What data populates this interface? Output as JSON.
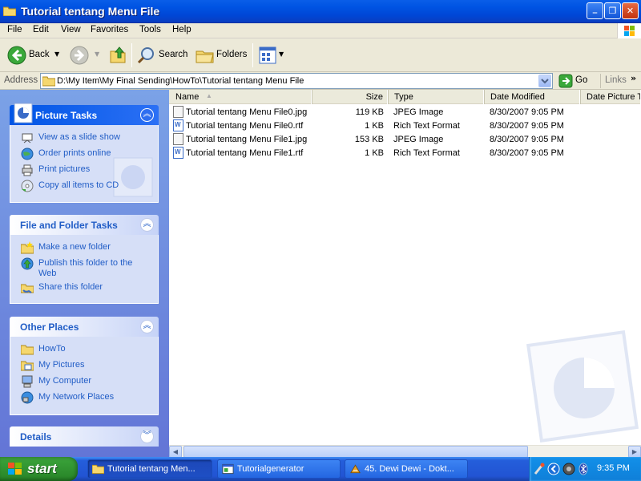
{
  "window": {
    "title": "Tutorial tentang Menu File",
    "controls": {
      "minimize": "_",
      "maximize": "❐",
      "close": "✕"
    }
  },
  "menu": [
    "File",
    "Edit",
    "View",
    "Favorites",
    "Tools",
    "Help"
  ],
  "toolbar": {
    "back": "Back",
    "search": "Search",
    "folders": "Folders"
  },
  "address": {
    "label": "Address",
    "value": "D:\\My Item\\My Final Sending\\HowTo\\Tutorial tentang Menu File",
    "go": "Go",
    "links": "Links"
  },
  "panels": {
    "picture_tasks": {
      "title": "Picture Tasks",
      "items": [
        {
          "label": "View as a slide show",
          "icon": "slideshow-icon"
        },
        {
          "label": "Order prints online",
          "icon": "globe-icon"
        },
        {
          "label": "Print pictures",
          "icon": "printer-icon"
        },
        {
          "label": "Copy all items to CD",
          "icon": "cd-icon"
        }
      ]
    },
    "file_folder_tasks": {
      "title": "File and Folder Tasks",
      "items": [
        {
          "label": "Make a new folder",
          "icon": "new-folder-icon"
        },
        {
          "label": "Publish this folder to the Web",
          "icon": "publish-web-icon"
        },
        {
          "label": "Share this folder",
          "icon": "share-folder-icon"
        }
      ]
    },
    "other_places": {
      "title": "Other Places",
      "items": [
        {
          "label": "HowTo",
          "icon": "folder-icon"
        },
        {
          "label": "My Pictures",
          "icon": "my-pictures-icon"
        },
        {
          "label": "My Computer",
          "icon": "my-computer-icon"
        },
        {
          "label": "My Network Places",
          "icon": "network-places-icon"
        }
      ]
    },
    "details": {
      "title": "Details"
    }
  },
  "columns": [
    "Name",
    "Size",
    "Type",
    "Date Modified",
    "Date Picture T"
  ],
  "files": [
    {
      "name": "Tutorial tentang Menu File0.jpg",
      "size": "119 KB",
      "type": "JPEG Image",
      "modified": "8/30/2007 9:05 PM",
      "kind": "jpg"
    },
    {
      "name": "Tutorial tentang Menu File0.rtf",
      "size": "1 KB",
      "type": "Rich Text Format",
      "modified": "8/30/2007 9:05 PM",
      "kind": "rtf"
    },
    {
      "name": "Tutorial tentang Menu File1.jpg",
      "size": "153 KB",
      "type": "JPEG Image",
      "modified": "8/30/2007 9:05 PM",
      "kind": "jpg"
    },
    {
      "name": "Tutorial tentang Menu File1.rtf",
      "size": "1 KB",
      "type": "Rich Text Format",
      "modified": "8/30/2007 9:05 PM",
      "kind": "rtf"
    }
  ],
  "taskbar": {
    "start": "start",
    "buttons": [
      {
        "label": "Tutorial tentang Men...",
        "active": true
      },
      {
        "label": "Tutorialgenerator",
        "active": false
      },
      {
        "label": "45. Dewi Dewi - Dokt...",
        "active": false
      }
    ],
    "clock": "9:35 PM"
  }
}
